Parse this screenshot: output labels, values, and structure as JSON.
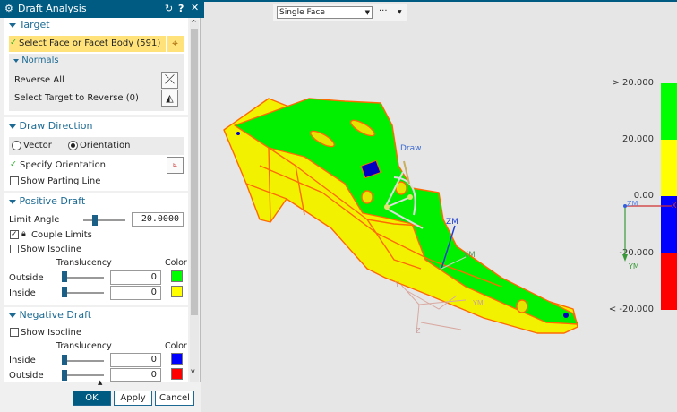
{
  "title": "Draft Analysis",
  "target": {
    "header": "Target",
    "select_label": "Select Face or Facet Body (591)",
    "normals": {
      "header": "Normals",
      "reverse_all": "Reverse All",
      "select_target": "Select Target to Reverse (0)"
    }
  },
  "draw_direction": {
    "header": "Draw Direction",
    "option_vector": "Vector",
    "option_orientation": "Orientation",
    "selected": "Orientation",
    "specify": "Specify Orientation",
    "show_parting_line": "Show Parting Line"
  },
  "positive_draft": {
    "header": "Positive Draft",
    "limit_angle_label": "Limit Angle",
    "limit_angle": "20.0000",
    "couple_limits": "Couple Limits",
    "couple_checked": true,
    "show_isocline": "Show Isocline",
    "translucency": "Translucency",
    "color": "Color",
    "outside": "Outside",
    "outside_value": "0",
    "outside_color": "#00ff00",
    "inside": "Inside",
    "inside_value": "0",
    "inside_color": "#ffff00"
  },
  "negative_draft": {
    "header": "Negative Draft",
    "show_isocline": "Show Isocline",
    "translucency": "Translucency",
    "color": "Color",
    "inside": "Inside",
    "inside_value": "0",
    "inside_color": "#0000ff",
    "outside": "Outside",
    "outside_value": "0",
    "outside_color": "#ff0000"
  },
  "buttons": {
    "ok": "OK",
    "apply": "Apply",
    "cancel": "Cancel"
  },
  "toolbar": {
    "filter": "Single Face",
    "more": "···"
  },
  "viewport": {
    "draw_label": "Draw",
    "zm": "ZM",
    "ym": "YM",
    "xm": "XM",
    "y": "Y",
    "z": "Z"
  },
  "legend": {
    "labels": [
      "> 20.000",
      "20.000",
      "0.00",
      "-20.000",
      "< -20.000"
    ],
    "colors": [
      "#00ff00",
      "#ffff00",
      "#0000ff",
      "#ff0000"
    ],
    "zm": "ZM",
    "ym": "YM",
    "x": "X"
  }
}
